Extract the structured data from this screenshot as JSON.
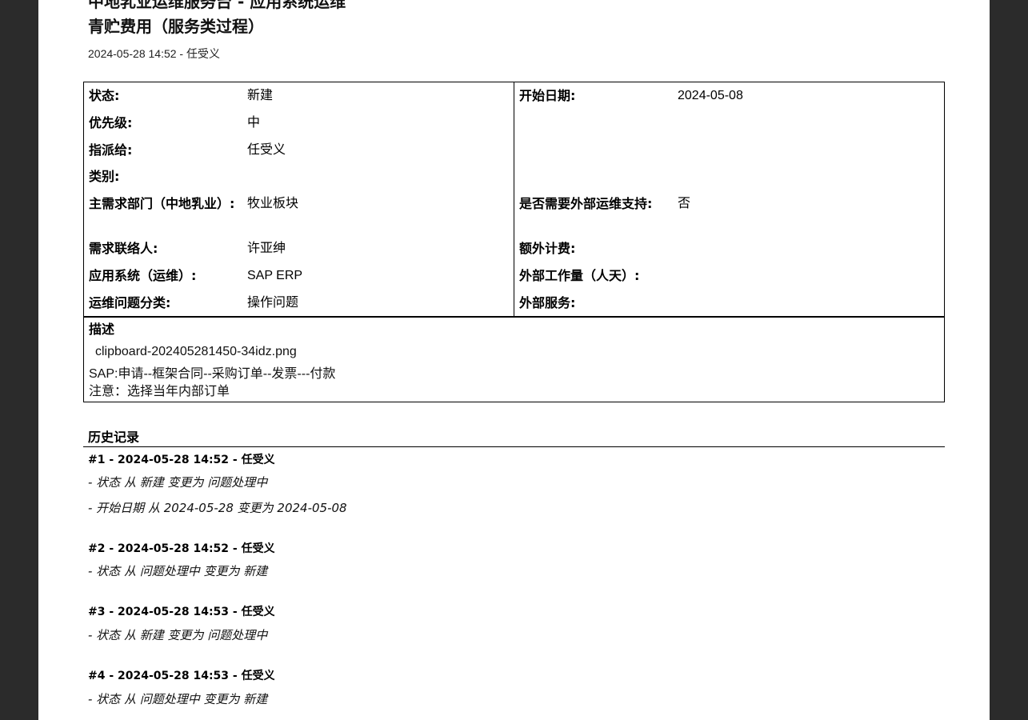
{
  "header": {
    "cut_title": "中地乳业运维服务台 - 应用系统运维",
    "title": "青贮费用（服务类过程）",
    "meta": "2024-05-28 14:52 - 任受义"
  },
  "attributes_left": [
    {
      "label": "状态:",
      "value": "新建"
    },
    {
      "label": "优先级:",
      "value": "中"
    },
    {
      "label": "指派给:",
      "value": "任受义"
    },
    {
      "label": "类别:",
      "value": ""
    },
    {
      "label": "主需求部门（中地乳业）:",
      "value": "牧业板块"
    },
    {
      "label": "需求联络人:",
      "value": "许亚绅"
    },
    {
      "label": "应用系统（运维）:",
      "value": "SAP ERP"
    },
    {
      "label": "运维问题分类:",
      "value": "操作问题"
    }
  ],
  "attributes_right": [
    {
      "label": "开始日期:",
      "value": "2024-05-08"
    },
    {
      "label": "是否需要外部运维支持:",
      "value": "否"
    },
    {
      "label": "额外计费:",
      "value": ""
    },
    {
      "label": "外部工作量（人天）:",
      "value": ""
    },
    {
      "label": "外部服务:",
      "value": ""
    }
  ],
  "description": {
    "label": "描述",
    "attachment": "clipboard-202405281450-34idz.png",
    "line1": "SAP:申请--框架合同--采购订单--发票---付款",
    "line2": "注意：选择当年内部订单"
  },
  "history": {
    "title": "历史记录",
    "entries": [
      {
        "head": "#1 - 2024-05-28 14:52 - 任受义",
        "details": [
          "- 状态 从 新建 变更为 问题处理中",
          "- 开始日期 从 2024-05-28 变更为 2024-05-08"
        ]
      },
      {
        "head": "#2 - 2024-05-28 14:52 - 任受义",
        "details": [
          "- 状态 从 问题处理中 变更为 新建"
        ]
      },
      {
        "head": "#3 - 2024-05-28 14:53 - 任受义",
        "details": [
          "- 状态 从 新建 变更为 问题处理中"
        ]
      },
      {
        "head": "#4 - 2024-05-28 14:53 - 任受义",
        "details": [
          "- 状态 从 问题处理中 变更为 新建"
        ]
      }
    ]
  }
}
